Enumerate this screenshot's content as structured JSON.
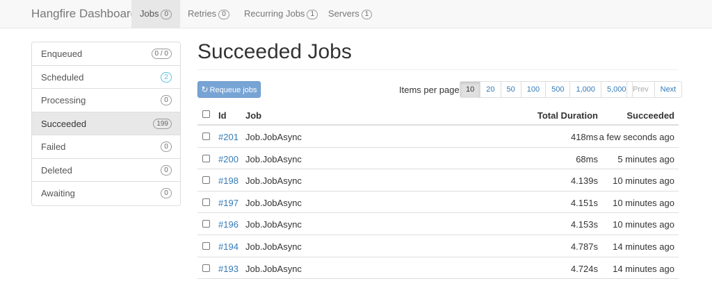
{
  "navbar": {
    "brand": "Hangfire Dashboard",
    "items": [
      {
        "label": "Jobs",
        "count": "0"
      },
      {
        "label": "Retries",
        "count": "0"
      },
      {
        "label": "Recurring Jobs",
        "count": "1"
      },
      {
        "label": "Servers",
        "count": "1"
      }
    ]
  },
  "sidebar": {
    "items": [
      {
        "label": "Enqueued",
        "count": "0 / 0"
      },
      {
        "label": "Scheduled",
        "count": "2"
      },
      {
        "label": "Processing",
        "count": "0"
      },
      {
        "label": "Succeeded",
        "count": "199"
      },
      {
        "label": "Failed",
        "count": "0"
      },
      {
        "label": "Deleted",
        "count": "0"
      },
      {
        "label": "Awaiting",
        "count": "0"
      }
    ]
  },
  "main": {
    "title": "Succeeded Jobs",
    "requeue_label": "Requeue jobs",
    "items_per_page_label": "Items per page:",
    "page_sizes": [
      "10",
      "20",
      "50",
      "100",
      "500",
      "1,000",
      "5,000"
    ],
    "prev_label": "Prev",
    "next_label": "Next"
  },
  "table": {
    "headers": {
      "id": "Id",
      "job": "Job",
      "duration": "Total Duration",
      "succeeded": "Succeeded"
    },
    "rows": [
      {
        "id": "#201",
        "job": "Job.JobAsync",
        "duration": "418ms",
        "succeeded": "a few seconds ago"
      },
      {
        "id": "#200",
        "job": "Job.JobAsync",
        "duration": "68ms",
        "succeeded": "5 minutes ago"
      },
      {
        "id": "#198",
        "job": "Job.JobAsync",
        "duration": "4.139s",
        "succeeded": "10 minutes ago"
      },
      {
        "id": "#197",
        "job": "Job.JobAsync",
        "duration": "4.151s",
        "succeeded": "10 minutes ago"
      },
      {
        "id": "#196",
        "job": "Job.JobAsync",
        "duration": "4.153s",
        "succeeded": "10 minutes ago"
      },
      {
        "id": "#194",
        "job": "Job.JobAsync",
        "duration": "4.787s",
        "succeeded": "14 minutes ago"
      },
      {
        "id": "#193",
        "job": "Job.JobAsync",
        "duration": "4.724s",
        "succeeded": "14 minutes ago"
      }
    ]
  },
  "colors": {
    "link": "#337ab7",
    "primary_button": "#77a4d4",
    "info_badge": "#5bc0de"
  }
}
